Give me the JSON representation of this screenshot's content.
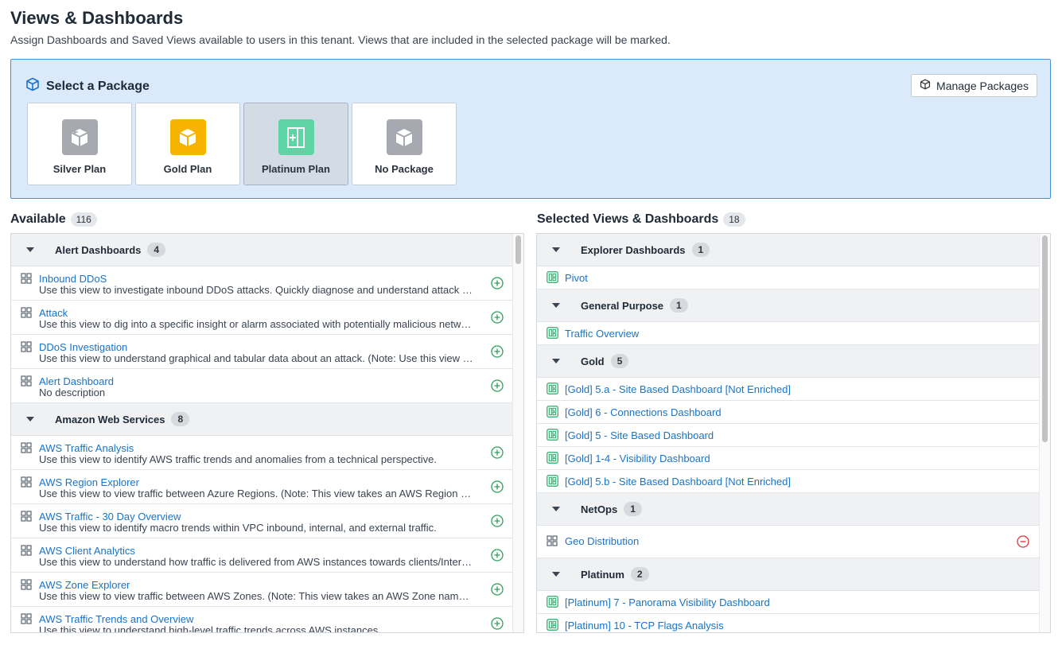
{
  "page": {
    "title": "Views & Dashboards",
    "subtitle": "Assign Dashboards and Saved Views available to users in this tenant. Views that are included in the selected package will be marked."
  },
  "package_panel": {
    "title": "Select a Package",
    "manage_label": "Manage Packages",
    "packages": [
      {
        "label": "Silver Plan",
        "color": "#a6aab0",
        "icon": "box-arrow-icon",
        "selected": false
      },
      {
        "label": "Gold Plan",
        "color": "#f6b400",
        "icon": "box-icon",
        "selected": false
      },
      {
        "label": "Platinum Plan",
        "color": "#5fd4a4",
        "icon": "box-plus-icon",
        "selected": true
      },
      {
        "label": "No Package",
        "color": "#a6aab0",
        "icon": "box-icon",
        "selected": false
      }
    ]
  },
  "available": {
    "title": "Available",
    "count": "116",
    "groups": [
      {
        "name": "Alert Dashboards",
        "count": "4",
        "items": [
          {
            "name": "Inbound DDoS",
            "desc": "Use this view to investigate inbound DDoS attacks. Quickly diagnose and understand attack impact."
          },
          {
            "name": "Attack",
            "desc": "Use this view to dig into a specific insight or alarm associated with potentially malicious network activity."
          },
          {
            "name": "DDoS Investigation",
            "desc": "Use this view to understand graphical and tabular data about an attack. (Note: Use this view with an alert.)"
          },
          {
            "name": "Alert Dashboard",
            "desc": "No description"
          }
        ]
      },
      {
        "name": "Amazon Web Services",
        "count": "8",
        "items": [
          {
            "name": "AWS Traffic Analysis",
            "desc": "Use this view to identify AWS traffic trends and anomalies from a technical perspective."
          },
          {
            "name": "AWS Region Explorer",
            "desc": "Use this view to view traffic between Azure Regions. (Note: This view takes an AWS Region name as input.)"
          },
          {
            "name": "AWS Traffic - 30 Day Overview",
            "desc": "Use this view to identify macro trends within VPC inbound, internal, and external traffic."
          },
          {
            "name": "AWS Client Analytics",
            "desc": "Use this view to understand how traffic is delivered from AWS instances towards clients/Internet."
          },
          {
            "name": "AWS Zone Explorer",
            "desc": "Use this view to view traffic between AWS Zones. (Note: This view takes an AWS Zone name as input.)"
          },
          {
            "name": "AWS Traffic Trends and Overview",
            "desc": "Use this view to understand high-level traffic trends across AWS instances."
          }
        ]
      }
    ]
  },
  "selected": {
    "title": "Selected Views & Dashboards",
    "count": "18",
    "groups": [
      {
        "name": "Explorer Dashboards",
        "count": "1",
        "items": [
          {
            "name": "Pivot",
            "type": "dashboard"
          }
        ]
      },
      {
        "name": "General Purpose",
        "count": "1",
        "items": [
          {
            "name": "Traffic Overview",
            "type": "dashboard"
          }
        ]
      },
      {
        "name": "Gold",
        "count": "5",
        "items": [
          {
            "name": "[Gold] 5.a - Site Based Dashboard [Not Enriched]",
            "type": "dashboard"
          },
          {
            "name": "[Gold] 6 - Connections Dashboard",
            "type": "dashboard"
          },
          {
            "name": "[Gold] 5 - Site Based Dashboard",
            "type": "dashboard"
          },
          {
            "name": "[Gold] 1-4 - Visibility Dashboard",
            "type": "dashboard"
          },
          {
            "name": "[Gold] 5.b - Site Based Dashboard [Not Enriched]",
            "type": "dashboard"
          }
        ]
      },
      {
        "name": "NetOps",
        "count": "1",
        "items": [
          {
            "name": "Geo Distribution",
            "type": "view",
            "removable": true
          }
        ]
      },
      {
        "name": "Platinum",
        "count": "2",
        "items": [
          {
            "name": "[Platinum] 7 - Panorama Visibility Dashboard",
            "type": "dashboard"
          },
          {
            "name": "[Platinum] 10 - TCP Flags Analysis",
            "type": "dashboard"
          }
        ]
      }
    ]
  },
  "colors": {
    "link": "#1a73c8",
    "add": "#2e9e5b",
    "remove": "#d9363e",
    "panel_bg": "#dbeafb",
    "panel_border": "#4a90d9",
    "dashboard_icon": "#43b47a"
  }
}
